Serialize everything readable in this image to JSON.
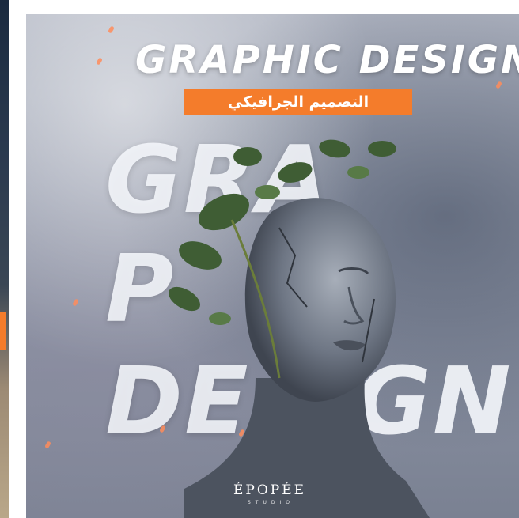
{
  "poster": {
    "title": "GRAPHIC DESIGN",
    "subtitle": "التصميم الجرافيكي",
    "background_letters": {
      "line1": "GRA",
      "line2": "P",
      "line3": "DE",
      "line3_tail": "GN"
    },
    "brand": "ÉPOPÉE",
    "brand_tagline": "STUDIO"
  },
  "colors": {
    "accent": "#f47c2b",
    "title": "#ffffff",
    "sculpture": "#6e7684",
    "leaf": "#3f5d34"
  },
  "icons": {
    "sculpture": "stone-face-with-leaves"
  }
}
